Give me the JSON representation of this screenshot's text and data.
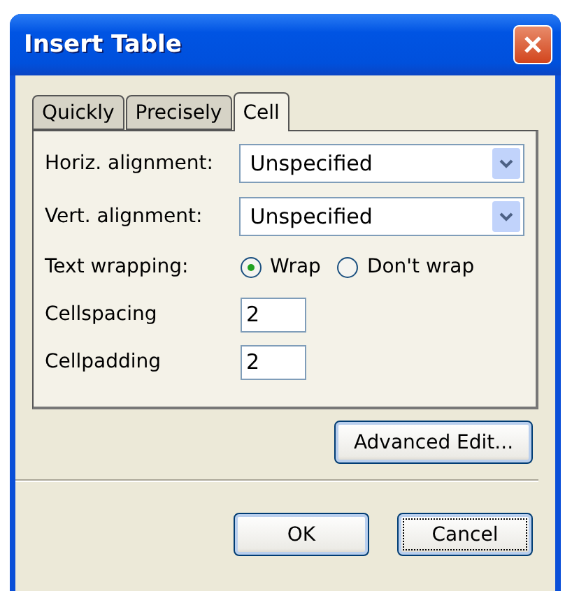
{
  "window": {
    "title": "Insert Table"
  },
  "tabs": [
    {
      "label": "Quickly",
      "selected": false
    },
    {
      "label": "Precisely",
      "selected": false
    },
    {
      "label": "Cell",
      "selected": true
    }
  ],
  "rows": [
    {
      "kind": "select",
      "label": "Horiz. alignment:",
      "value": "Unspecified"
    },
    {
      "kind": "select",
      "label": "Vert. alignment:",
      "value": "Unspecified"
    },
    {
      "kind": "radio",
      "label": "Text wrapping:",
      "options": [
        {
          "label": "Wrap",
          "selected": true
        },
        {
          "label": "Don't wrap",
          "selected": false
        }
      ]
    },
    {
      "kind": "input",
      "label": "Cellspacing",
      "value": "2"
    },
    {
      "kind": "input",
      "label": "Cellpadding",
      "value": "2"
    }
  ],
  "advanced_button": "Advanced Edit...",
  "buttons": [
    {
      "label": "OK",
      "focused": false
    },
    {
      "label": "Cancel",
      "focused": true
    }
  ]
}
